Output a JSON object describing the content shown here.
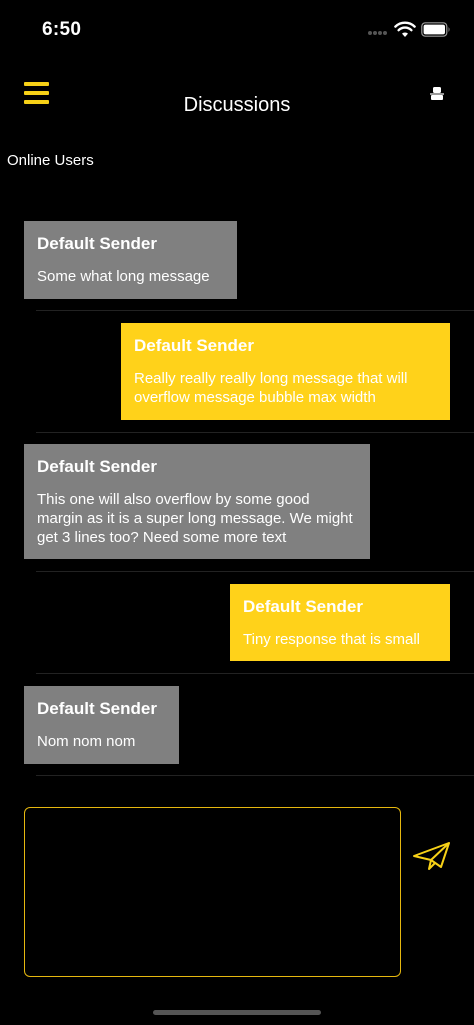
{
  "status_bar": {
    "time": "6:50"
  },
  "nav": {
    "title": "Discussions",
    "menu_icon": "hamburger-menu-icon",
    "user_icon": "user-profile-icon"
  },
  "online_users_label": "Online Users",
  "messages": [
    {
      "sender": "Default Sender",
      "text": "Some what long message",
      "direction": "received"
    },
    {
      "sender": "Default Sender",
      "text": "Really really really long message that will overflow message bubble max width",
      "direction": "sent"
    },
    {
      "sender": "Default Sender",
      "text": "This one will also overflow by some good margin as it is a super long message. We might get 3 lines too? Need some more text",
      "direction": "received"
    },
    {
      "sender": "Default Sender",
      "text": "Tiny response that is small",
      "direction": "sent"
    },
    {
      "sender": "Default Sender",
      "text": "Nom nom nom",
      "direction": "received"
    }
  ],
  "composer": {
    "value": "",
    "send_icon": "paper-plane-icon"
  },
  "colors": {
    "accent": "#ffd21a",
    "received_bubble": "#808080",
    "background": "#000000"
  }
}
